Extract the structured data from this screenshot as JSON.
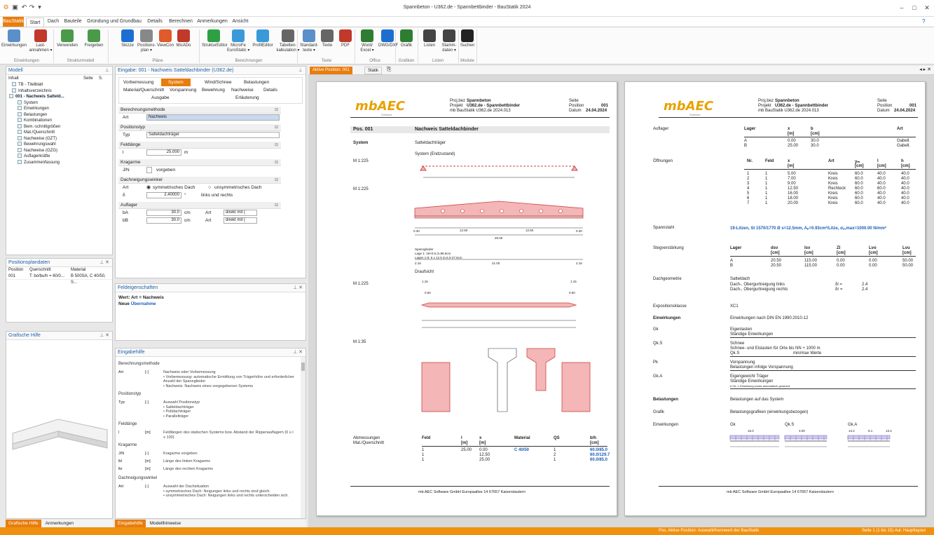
{
  "window": {
    "title": "Spannbeton - U362.de - Spannbettbinder - BauStatik 2024",
    "min": "–",
    "max": "□",
    "close": "✕"
  },
  "quickaccess": [
    "⚙",
    "▣",
    "↶",
    "↷",
    "▾"
  ],
  "tabs": [
    "BauStatik",
    "Start",
    "Dach",
    "Bauteile",
    "Gründung und Grundbau",
    "Details",
    "Berechnen",
    "Anmerkungen",
    "Ansicht"
  ],
  "ribbon": {
    "buttons": [
      {
        "label": "Einwirkungen",
        "c": "#5a8fc9"
      },
      {
        "label": "Last-\nannahmen ▾",
        "c": "#c0392b"
      },
      {
        "label": "Verwenden",
        "c": "#4a9a4a"
      },
      {
        "label": "Freigeben",
        "c": "#4a9a4a"
      },
      {
        "label": "Skizze",
        "c": "#1c6fd1"
      },
      {
        "label": "Positions-\nplan ▾",
        "c": "#888"
      },
      {
        "label": "ViewCon",
        "c": "#e05a2a"
      },
      {
        "label": "MicADo",
        "c": "#c0392b"
      },
      {
        "label": "StrukturEditor",
        "c": "#2ea043"
      },
      {
        "label": "MicroFe\nEuroStatic ▾",
        "c": "#3a9ad9"
      },
      {
        "label": "ProfilEditor",
        "c": "#3a9ad9"
      },
      {
        "label": "Tabellen-\nkalkulation ▾",
        "c": "#666"
      },
      {
        "label": "Standard-\ntexte ▾",
        "c": "#5a8fc9"
      },
      {
        "label": "Texte",
        "c": "#666"
      },
      {
        "label": "PDF",
        "c": "#c0392b"
      },
      {
        "label": "Word/\nExcel ▾",
        "c": "#2e7d32"
      },
      {
        "label": "DWG/DXF",
        "c": "#1c6fd1"
      },
      {
        "label": "Grafik",
        "c": "#2e7d32"
      },
      {
        "label": "Listen",
        "c": "#444"
      },
      {
        "label": "Stamm-\ndaten ▾",
        "c": "#444"
      },
      {
        "label": "Suchen",
        "c": "#222"
      }
    ],
    "groups": [
      "Einwirkungen",
      "Strukturmodell",
      "Pläne",
      "Berechnungen",
      "Texte",
      "Office",
      "Grafiken",
      "Listen",
      "Module"
    ]
  },
  "model_panel": {
    "title": "Modell",
    "inhalt": "Inhalt",
    "seite": "Seite",
    "s": "S.",
    "tree": [
      "TB - Titelblatt",
      "Inhaltsverzeichnis",
      "001 - Nachweis Satteld...",
      "System",
      "Einwirkungen",
      "Belastungen",
      "Kombinationen",
      "Bem.-schnittgrößen",
      "Mat./Querschnitt",
      "Nachweise (GZT)",
      "Bewehrungswahl",
      "Nachweise (GZG)",
      "Auflagerkräfte",
      "Zusammenfassung"
    ]
  },
  "posplan": {
    "title": "Positionsplandaten",
    "cols": [
      "Position",
      "Querschnitt",
      "Material"
    ],
    "row": [
      "001",
      "T: bo/bu/h = 60/0...",
      "B 500SA, C 40/50, S..."
    ]
  },
  "grafhilfe": {
    "title": "Grafische Hilfe"
  },
  "left_tabs": [
    "Grafische Hilfe",
    "Anmerkungen"
  ],
  "input_panel": {
    "title": "Eingabe: 001 - Nachweis Satteldachbinder (U362.de)",
    "tabs_row1": [
      "Vorbemessung",
      "System",
      "Wind/Schnee",
      "Belastungen"
    ],
    "tabs_row2": [
      "Material/Querschnitt",
      "Vorspannung",
      "Bewehrung",
      "Nachweise",
      "Details"
    ],
    "tabs_row3": [
      "Ausgabe",
      "Erläuterung"
    ],
    "sec1": "Berechnungsmethode",
    "art_label": "Art",
    "art_value": "Nachweis",
    "sec2": "Positionstyp",
    "typ_label": "Typ",
    "typ_value": "Satteldachträger",
    "sec3": "Feldlänge",
    "l_label": "l",
    "l_value": "25.000",
    "l_unit": "m",
    "sec4": "Kragarme",
    "jn_label": "J/N",
    "vorgeben": "vorgeben",
    "sec5": "Dachneigungswinkel",
    "art2_label": "Art",
    "sym": "symmetrisches Dach",
    "unsym": "unsymmetrisches Dach",
    "delta_label": "δ",
    "delta_value": "2.40000",
    "deg": "°",
    "lr": "links und rechts",
    "sec6": "Auflager",
    "ba_label": "bA",
    "ba_value": "30.0",
    "bb_label": "bB",
    "bb_value": "30.0",
    "cm": "cm",
    "art_l": "Art",
    "art_v": "direkt mit ("
  },
  "feld": {
    "title": "Feldeigenschaften",
    "line1": "Wert: Art = Nachweis",
    "line2a": "Neue ",
    "line2b": "Übernahme"
  },
  "hilfe": {
    "title": "Eingabehilfe",
    "rows": [
      {
        "h": "Berechnungsmethode"
      },
      {
        "k": "Art",
        "u": "[-]",
        "t": "Nachweis oder Vorbemessung\n• Vorbemessung: automatische Ermittlung von Trägerhöhe und erforderlicher Anzahl der Spannglieder\n• Nachweis: Nachweis eines vorgegebenen Systems"
      },
      {
        "h": "Positionstyp"
      },
      {
        "k": "Typ",
        "u": "[-]",
        "t": "Auswahl Positionstyp\n• Satteldachträger\n• Pultdachträger\n• Parallelträger"
      },
      {
        "h": "Feldlänge"
      },
      {
        "k": "l",
        "u": "[m]",
        "t": "Feldlängen des statischen Systems bzw. Abstand der Rippenauflagern (0 ≤ l ≤ 100)"
      },
      {
        "h": "Kragarme"
      },
      {
        "k": "J/N",
        "u": "[-]",
        "t": "Kragarme vorgeben"
      },
      {
        "k": "lkl",
        "u": "[m]",
        "t": "Länge des linken Kragarms"
      },
      {
        "k": "lkr",
        "u": "[m]",
        "t": "Länge des rechten Kragarms"
      },
      {
        "h": "Dachneigungswinkel"
      },
      {
        "k": "Art",
        "u": "[-]",
        "t": "Auswahl der Dachsituation\n• symmetrisches Dach: Neigungen links und rechts sind gleich.\n• unsymmetrisches Dach: Neigungen links und rechts unterscheiden sich."
      }
    ]
  },
  "center_tabs": [
    "Eingabehilfe",
    "Modellhinweise"
  ],
  "doc_tabs": [
    "Aktive Position: 001",
    "Statik"
  ],
  "page1": {
    "logo": "mbAEC",
    "logo_sub": "Software",
    "h_proj_l": "Proj.bez",
    "h_proj_v": "Spannbeton",
    "h_projekt_l": "Projekt",
    "h_projekt_v": "U362.de - Spannbettbinder",
    "h_mb": "mb BauStatik U362.de 2024.013",
    "h_seite": "Seite",
    "h_position_l": "Position",
    "h_position_v": "001",
    "h_datum_l": "Datum",
    "h_datum_v": "24.04.2024",
    "pos": "Pos. 001",
    "pos_title": "Nachweis Satteldachbinder",
    "system_l": "System",
    "system_v": "Satteldachträger",
    "sys_end": "System (Endzustand)",
    "m1": "M 1:225",
    "m2": "M 1:225",
    "m3": "M 1:225",
    "m4": "M 1:35",
    "dim25": "25.00",
    "dim1250": "12.50",
    "dim1250b": "12.50",
    "dim030": "0.30",
    "dim030b": "0.30",
    "spann": "Spannglieder",
    "lage1": "Lage 1: 18×0.5  d=98.6cm",
    "lage2": "Lagen 1-8: 6 x 12.5  d=6.0-27.6cm",
    "s_216": "2.16",
    "s_2100": "21.00",
    "s_216b": "2.16",
    "draufsicht": "Draufsicht",
    "d115": "1.15",
    "d115b": "1.15",
    "d060": "0.60",
    "d060b": "0.60",
    "abm_l1": "Abmessungen",
    "abm_l2": "Mat./Querschnitt",
    "tcols": [
      "Feld",
      "l",
      "x",
      "Material",
      "QS",
      "b/h"
    ],
    "tunits": [
      "",
      "[m]",
      "[m]",
      "",
      "",
      "[cm]"
    ],
    "trows": [
      [
        "1",
        "25.00",
        "0.00",
        "C 40/50",
        "1",
        "60.0/85.0"
      ],
      [
        "1",
        "",
        "12.50",
        "",
        "2",
        "60.0/129.7"
      ],
      [
        "1",
        "",
        "25.00",
        "",
        "1",
        "60.0/85.0"
      ]
    ],
    "footer": "mb AEC Software GmbH    Europaallee 14    67657 Kaiserslautern"
  },
  "page2": {
    "logo": "mbAEC",
    "logo_sub": "Software",
    "h_proj_l": "Proj.bez",
    "h_proj_v": "Spannbeton",
    "h_projekt_l": "Projekt",
    "h_projekt_v": "U362.de - Spannbettbinder",
    "h_mb": "mb BauStatik U362.de 2024.013",
    "h_seite": "Seite",
    "h_position_l": "Position",
    "h_position_v": "001",
    "h_datum_l": "Datum",
    "h_datum_v": "24.04.2024",
    "auflager_l": "Auflager",
    "auf_cols": [
      "Lager",
      "x",
      "b",
      "Art"
    ],
    "auf_units": [
      "",
      "[m]",
      "[cm]",
      ""
    ],
    "auf_rows": [
      [
        "A",
        "0.00",
        "30.0",
        "Gabell."
      ],
      [
        "B",
        "25.00",
        "30.0",
        "Gabell."
      ]
    ],
    "oeff_l": "Öffnungen",
    "oe_cols": [
      "Nr.",
      "Feld",
      "x",
      "Art",
      "yₘ",
      "l",
      "h"
    ],
    "oe_units": [
      "",
      "",
      "[m]",
      "",
      "[cm]",
      "[cm]",
      "[cm]"
    ],
    "oe_rows": [
      [
        "1",
        "1",
        "5.00",
        "Kreis",
        "60.0",
        "40.0",
        "40.0"
      ],
      [
        "2",
        "1",
        "7.00",
        "Kreis",
        "60.0",
        "40.0",
        "40.0"
      ],
      [
        "3",
        "1",
        "9.00",
        "Kreis",
        "60.0",
        "40.0",
        "40.0"
      ],
      [
        "4",
        "1",
        "12.50",
        "Rechteck",
        "60.0",
        "60.0",
        "40.0"
      ],
      [
        "5",
        "1",
        "16.00",
        "Kreis",
        "60.0",
        "40.0",
        "40.0"
      ],
      [
        "6",
        "1",
        "18.00",
        "Kreis",
        "60.0",
        "40.0",
        "40.0"
      ],
      [
        "7",
        "1",
        "20.00",
        "Kreis",
        "60.0",
        "40.0",
        "40.0"
      ]
    ],
    "spannstahl_l": "Spannstahl",
    "spannstahl_v": "19-Litzen, St 1570/1770 Ø s=12.5mm, Aₚ=0.93cm²/Litze, σₚ,max=1000.00 N/mm²",
    "steg_l": "Stegverstärkung",
    "st_cols": [
      "Lager",
      "dsv",
      "lsv",
      "Zl",
      "Lvo",
      "Lvu"
    ],
    "st_units": [
      "",
      "[cm]",
      "[cm]",
      "[cm]",
      "[cm]",
      "[cm]"
    ],
    "st_rows": [
      [
        "A",
        "20.50",
        "115.00",
        "0.00",
        "0.00",
        "50.00"
      ],
      [
        "B",
        "20.50",
        "115.00",
        "0.00",
        "0.00",
        "50.00"
      ]
    ],
    "dach_l": "Dachgeometrie",
    "dach_v": "Satteldach",
    "dach_r1": "Dach-, Obergurtneigung links",
    "dach_r2": "Dach-, Obergurtneigung rechts",
    "dl_s": "δl  =",
    "dr_s": "δr  =",
    "dl_v": "2.4",
    "dr_v": "2.4",
    "exp_l": "Expositionsklasse",
    "exp_v": "XC1",
    "einw_l": "Einwirkungen",
    "einw_v": "Einwirkungen nach DIN EN 1990:2010-12",
    "gk": "Gk",
    "gk1": "Eigenlasten",
    "gk2": "Ständige Einwirkungen",
    "qks": "Qk.S",
    "qks1": "Schnee",
    "qks2": "Schnee- und Eislasten für Orte bis NN + 1000 m",
    "qks3": "Qk.S",
    "qks4": "min/max Werte",
    "pk": "Pk",
    "pk1": "Vorspannung",
    "pk2": "Belastungen infolge Vorspannung",
    "gka": "Gk.A",
    "gka1": "Eigengewicht Träger",
    "gka2": "Ständige Einwirkungen",
    "gka3": "# Gk. 1 Einwirkung wurde automatisch generiert.",
    "bel_l": "Belastungen",
    "bel_v": "Belastungen auf das System",
    "graf_l": "Grafik",
    "graf_v": "Belastungsgrafiken (einwirkungsbezogen)",
    "ein2_l": "Einwirkungen",
    "g1": "Gk",
    "g2": "Qk.S",
    "g3": "Gk.A",
    "gv1": "15.0",
    "gv2": "3.00",
    "gv3a": "13.2",
    "gv3b": "8.1",
    "gv3c": "13.2",
    "gd": "25.00",
    "footer": "mb AEC Software GmbH    Europaallee 14    67657 Kaiserslautern"
  },
  "status": {
    "left": "Pos. Aktive Position: Auswahl/Kennwert der BauStatik",
    "right": "Seite 1 (1 bis 15)  Aut. Hauptlayout"
  },
  "colors": {
    "accent": "#e87d0d",
    "blue": "#1a5fb4",
    "pink": "#f4b6b6"
  }
}
